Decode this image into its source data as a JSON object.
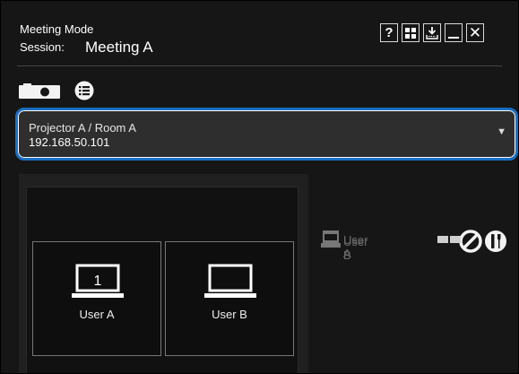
{
  "title": {
    "mode": "Meeting Mode",
    "session_label": "Session:",
    "session_name": "Meeting A"
  },
  "window_buttons": {
    "help": "?",
    "grid": "grid-icon",
    "save": "download-icon",
    "minimize": "minimize-icon",
    "close": "✕"
  },
  "source_select": {
    "selected_name": "Projector A / Room A",
    "selected_ip": "192.168.50.101"
  },
  "display_slots": [
    {
      "number": "1",
      "label": "User A"
    },
    {
      "number": "",
      "label": "User B"
    }
  ],
  "users": [
    {
      "name": "User A"
    },
    {
      "name": "User B"
    }
  ],
  "colors": {
    "window_bg": "#161616",
    "dropdown_border": "#1a6fc4",
    "dimmed_text": "#6a6a6a"
  }
}
